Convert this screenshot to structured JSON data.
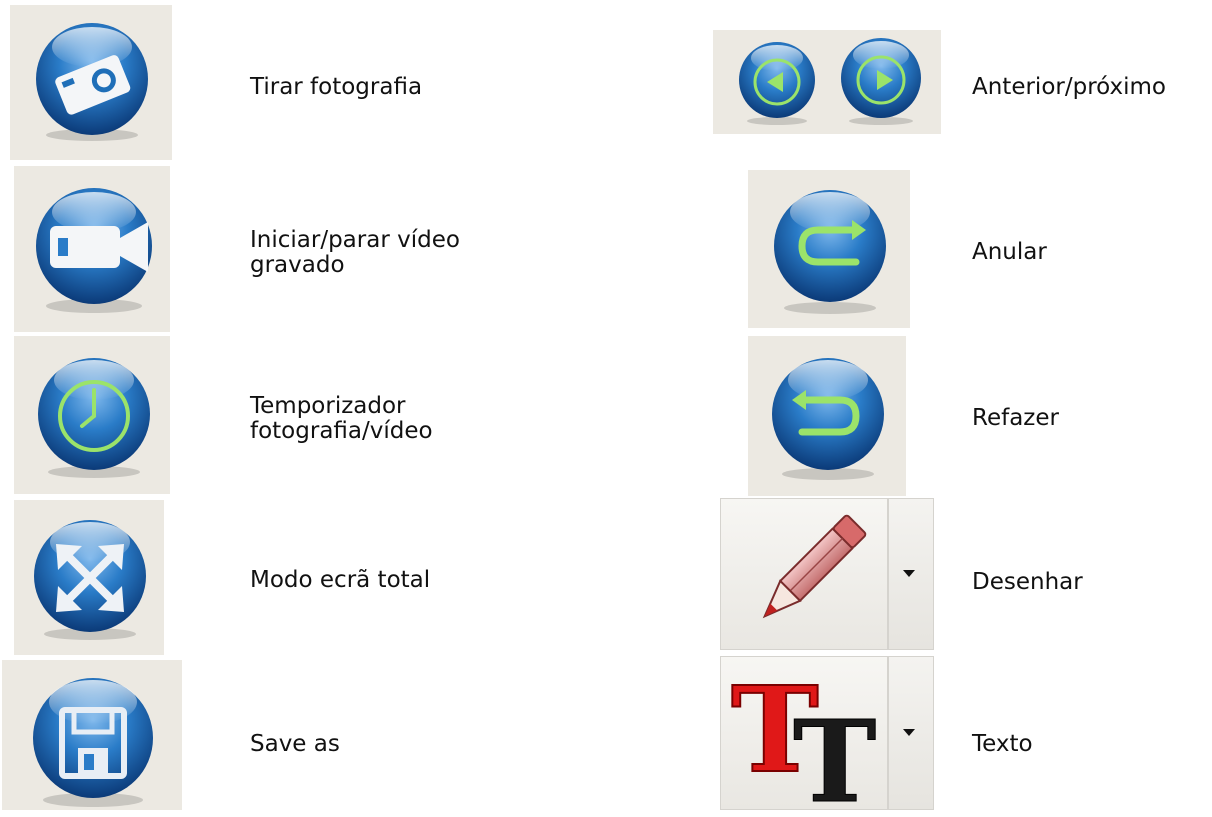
{
  "legend": {
    "left": [
      {
        "icon": "camera-icon",
        "lines": [
          "Tirar fotografia"
        ]
      },
      {
        "icon": "video-camera-icon",
        "lines": [
          "Iniciar/parar vídeo",
          "gravado"
        ]
      },
      {
        "icon": "clock-icon",
        "lines": [
          "Temporizador",
          "fotografia/vídeo"
        ]
      },
      {
        "icon": "fullscreen-arrows-icon",
        "lines": [
          "Modo ecrã total"
        ]
      },
      {
        "icon": "floppy-disk-icon",
        "lines": [
          "Save as"
        ]
      }
    ],
    "right": [
      {
        "icon": "previous-next-arrows-icon",
        "lines": [
          "Anterior/próximo"
        ]
      },
      {
        "icon": "undo-arrow-icon",
        "lines": [
          "Anular"
        ]
      },
      {
        "icon": "redo-arrow-icon",
        "lines": [
          "Refazer"
        ]
      },
      {
        "icon": "pencil-icon",
        "lines": [
          "Desenhar"
        ]
      },
      {
        "icon": "text-tool-icon",
        "lines": [
          "Texto"
        ]
      }
    ]
  },
  "colors": {
    "orb_blue": "#1f6fb8",
    "orb_dark": "#0d3f7a",
    "tile_bg": "#ece9e2",
    "accent_green": "#9be36a",
    "text_red": "#e01818"
  }
}
